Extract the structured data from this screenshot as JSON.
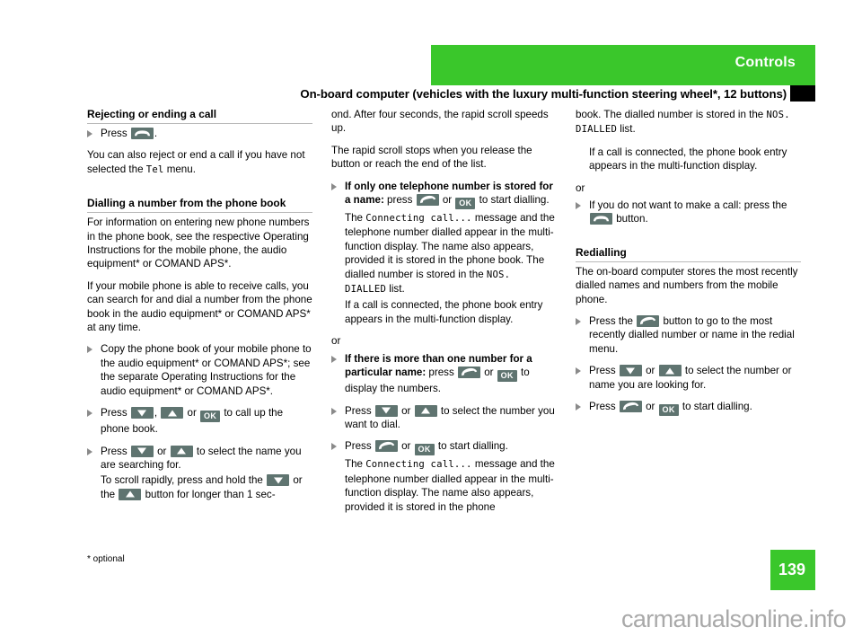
{
  "header": {
    "chapter": "Controls",
    "page_heading": "On-board computer (vehicles with the luxury multi-function steering wheel*, 12 buttons)"
  },
  "footer": {
    "footnote": "* optional",
    "page_number": "139",
    "watermark": "carmanualsonline.info"
  },
  "colors": {
    "brand_green": "#3ac72b",
    "key_gray": "#5f7470",
    "rule_gray": "#b9b9b9",
    "bullet_gray": "#8a8a8a"
  },
  "keys": {
    "ok_label": "OK",
    "hangup_icon": "phone-hangup-icon",
    "pickup_icon": "phone-pickup-icon",
    "down_icon": "arrow-down-icon",
    "up_icon": "arrow-up-icon"
  },
  "left_column": {
    "heading_1": "Rejecting or ending a call",
    "b1_press": "Press",
    "b1_tail": ".",
    "p1": "You can also reject or end a call if you have not selected the ",
    "p1_mono": "Tel",
    "p1_tail": " menu.",
    "heading_2": "Dialling a number from the phone book",
    "p2": "For information on entering new phone numbers in the phone book, see the respective Operating Instructions for the mobile phone, the audio equipment* or COMAND APS*.",
    "p3": "If your mobile phone is able to receive calls, you can search for and dial a number from the phone book in the audio equipment* or COMAND APS* at any time.",
    "b2": "Copy the phone book of your mobile phone to the audio equipment* or COMAND APS*; see the separate Operating Instructions for the audio equipment* or COMAND APS*.",
    "b3_press": "Press",
    "b3_mid": ", ",
    "b3_or": " or ",
    "b3_tail": " to call up the phone book.",
    "b4_press": "Press",
    "b4_or": " or ",
    "b4_tail": " to select the name you are searching for.",
    "b4_sub_pre": "To scroll rapidly, press and hold the ",
    "b4_sub_mid": " or the ",
    "b4_sub_tail": " button for longer than 1 sec-"
  },
  "middle_column": {
    "p1": "ond. After four seconds, the rapid scroll speeds up.",
    "p2": "The rapid scroll stops when you release the button or reach the end of the list.",
    "b1_bold": "If only one telephone number is stored for a name:",
    "b1_press": " press",
    "b1_or": " or ",
    "b1_tail": " to start dialling.",
    "b1_sub_pre": "The ",
    "b1_sub_mono": "Connecting call...",
    "b1_sub_mid": " message and the telephone number dialled appear in the multi-function display. The name also appears, provided it is stored in the phone book. The dialled number is stored in the ",
    "b1_sub_mono2": "NOS. DIALLED",
    "b1_sub_tail": " list.",
    "b1_sub2": "If a call is connected, the phone book entry appears in the multi-function display.",
    "or": "or",
    "b2_bold": "If there is more than one number for a particular name:",
    "b2_press": " press",
    "b2_or": " or ",
    "b2_tail": " to display the numbers.",
    "b3_press": "Press",
    "b3_or": " or ",
    "b3_tail": " to select the number you want to dial.",
    "b4_press": "Press",
    "b4_or": " or ",
    "b4_tail": " to start dialling.",
    "b4_sub_pre": "The ",
    "b4_sub_mono": "Connecting call...",
    "b4_sub_tail": " message and the telephone number dialled appear in the multi-function display. The name also appears, provided it is stored in the phone"
  },
  "right_column": {
    "p1_pre": "book. The dialled number is stored in the ",
    "p1_mono": "NOS. DIALLED",
    "p1_tail": " list.",
    "p2": "If a call is connected, the phone book entry appears in the multi-function display.",
    "or": "or",
    "b1_pre": "If you do not want to make a call: press the",
    "b1_tail": " button.",
    "heading": "Redialling",
    "p3": "The on-board computer stores the most recently dialled names and numbers from the mobile phone.",
    "b2_pre": "Press the",
    "b2_tail": " button to go to the most recently dialled number or name in the redial menu.",
    "b3_press": "Press",
    "b3_or": " or ",
    "b3_tail": " to select the number or name you are looking for.",
    "b4_press": "Press",
    "b4_or": " or ",
    "b4_tail": " to start dialling."
  }
}
